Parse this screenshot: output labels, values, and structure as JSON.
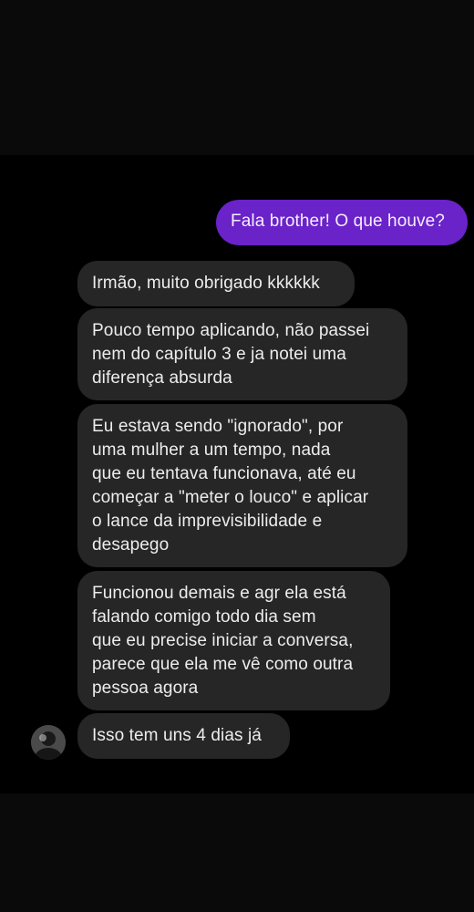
{
  "conversation": {
    "messages": [
      {
        "direction": "outgoing",
        "text": "Fala brother! O que houve?"
      },
      {
        "direction": "incoming",
        "text": "Irmão, muito obrigado kkkkkk"
      },
      {
        "direction": "incoming",
        "text": "Pouco tempo aplicando, não passei\nnem do capítulo 3 e ja notei uma\ndiferença absurda"
      },
      {
        "direction": "incoming",
        "text": "Eu estava sendo \"ignorado\", por\numa mulher a um tempo, nada\nque eu tentava funcionava, até eu\ncomeçar a \"meter o louco\" e aplicar\no lance da imprevisibilidade e\ndesapego"
      },
      {
        "direction": "incoming",
        "text": "Funcionou demais e agr ela está\nfalando comigo todo dia sem\nque eu precise iniciar a conversa,\nparece que ela me vê como outra\npessoa agora"
      },
      {
        "direction": "incoming",
        "text": "Isso tem uns 4 dias já"
      }
    ]
  },
  "colors": {
    "background": "#000000",
    "outgoing_bubble": "#6a22c9",
    "incoming_bubble": "#262626",
    "text": "#ededed"
  }
}
